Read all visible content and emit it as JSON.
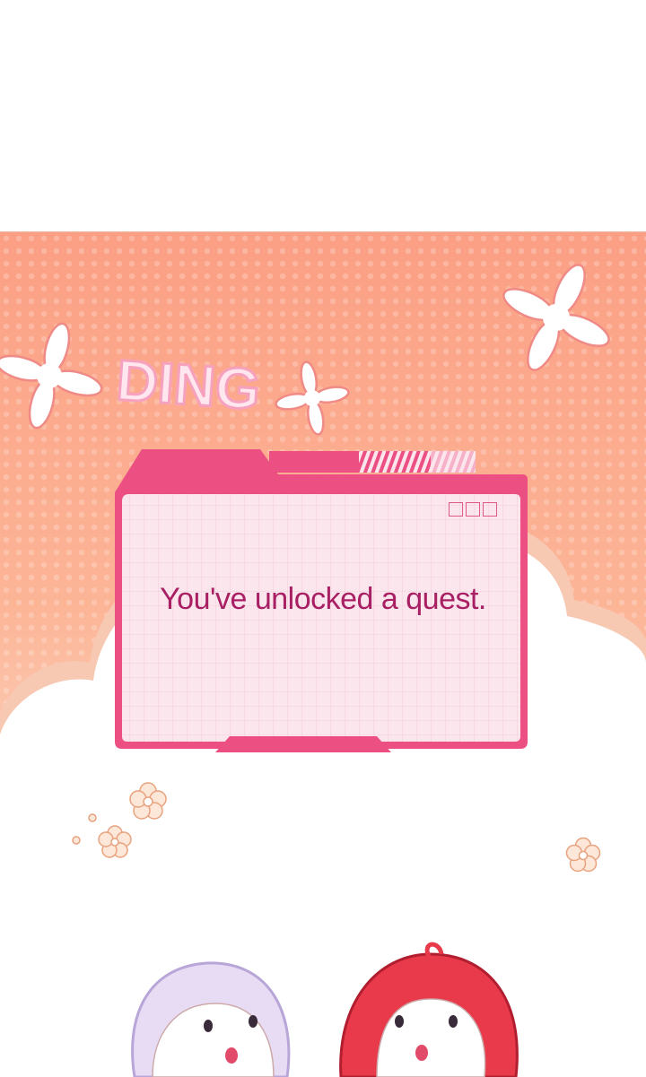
{
  "sfx": {
    "text": "DING"
  },
  "popup": {
    "message": "You've unlocked a quest."
  },
  "colors": {
    "background_top": "#fba287",
    "background_bottom": "#fdd8c6",
    "window_border": "#ec4f82",
    "window_fill": "#fbe6ee",
    "text": "#a81f63",
    "cloud": "#ffffff"
  },
  "icons": [
    "minimize-icon",
    "maximize-icon",
    "close-icon",
    "flower-sparkle-icon",
    "flower-doodle-icon"
  ],
  "characters": [
    "white-haired-chibi",
    "red-haired-chibi"
  ]
}
